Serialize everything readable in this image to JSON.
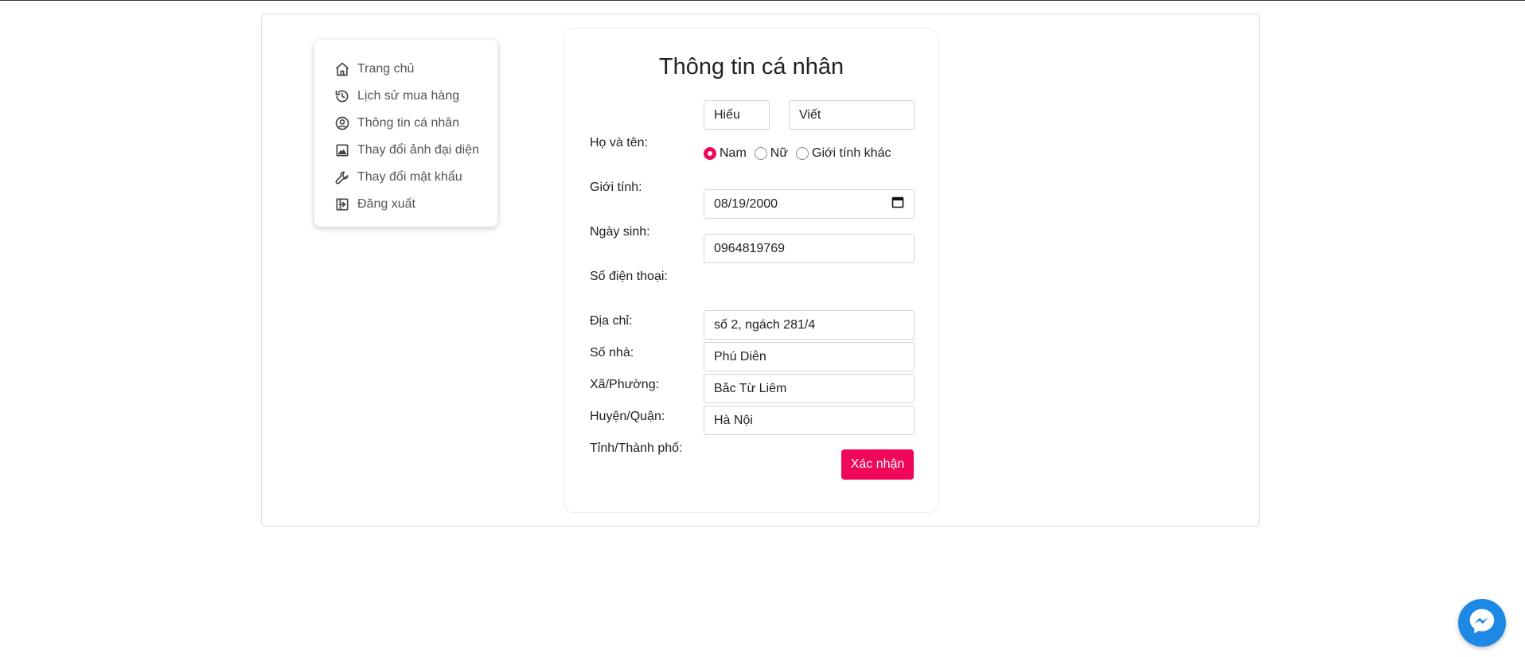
{
  "sidebar": {
    "items": [
      {
        "label": "Trang chủ",
        "icon": "home-icon"
      },
      {
        "label": "Lịch sử mua hàng",
        "icon": "history-icon"
      },
      {
        "label": "Thông tin cá nhân",
        "icon": "user-circle-icon"
      },
      {
        "label": "Thay đổi ảnh đại diện",
        "icon": "image-icon"
      },
      {
        "label": "Thay đổi mật khẩu",
        "icon": "wrench-icon"
      },
      {
        "label": "Đăng xuất",
        "icon": "logout-icon"
      }
    ]
  },
  "form": {
    "title": "Thông tin cá nhân",
    "name_label": "Họ và tên:",
    "first_name": "Hiếu",
    "last_name": "Viết",
    "gender_label": "Giới tính:",
    "gender_options": [
      "Nam",
      "Nữ",
      "Giới tính khác"
    ],
    "gender_selected": "Nam",
    "birth_label": "Ngày sinh:",
    "birth_value": "08/19/2000",
    "phone_label": "Số điện thoại:",
    "phone_value": "0964819769",
    "address_label": "Địa chỉ:",
    "house_label": "Số nhà:",
    "house_value": "số 2, ngách 281/4",
    "ward_label": "Xã/Phường:",
    "ward_value": "Phú Diễn",
    "district_label": "Huyện/Quận:",
    "district_value": "Bắc Từ Liêm",
    "city_label": "Tỉnh/Thành phố:",
    "city_value": "Hà Nội",
    "submit_label": "Xác nhận"
  },
  "colors": {
    "accent": "#f0065a",
    "messenger": "#1e88e5"
  }
}
